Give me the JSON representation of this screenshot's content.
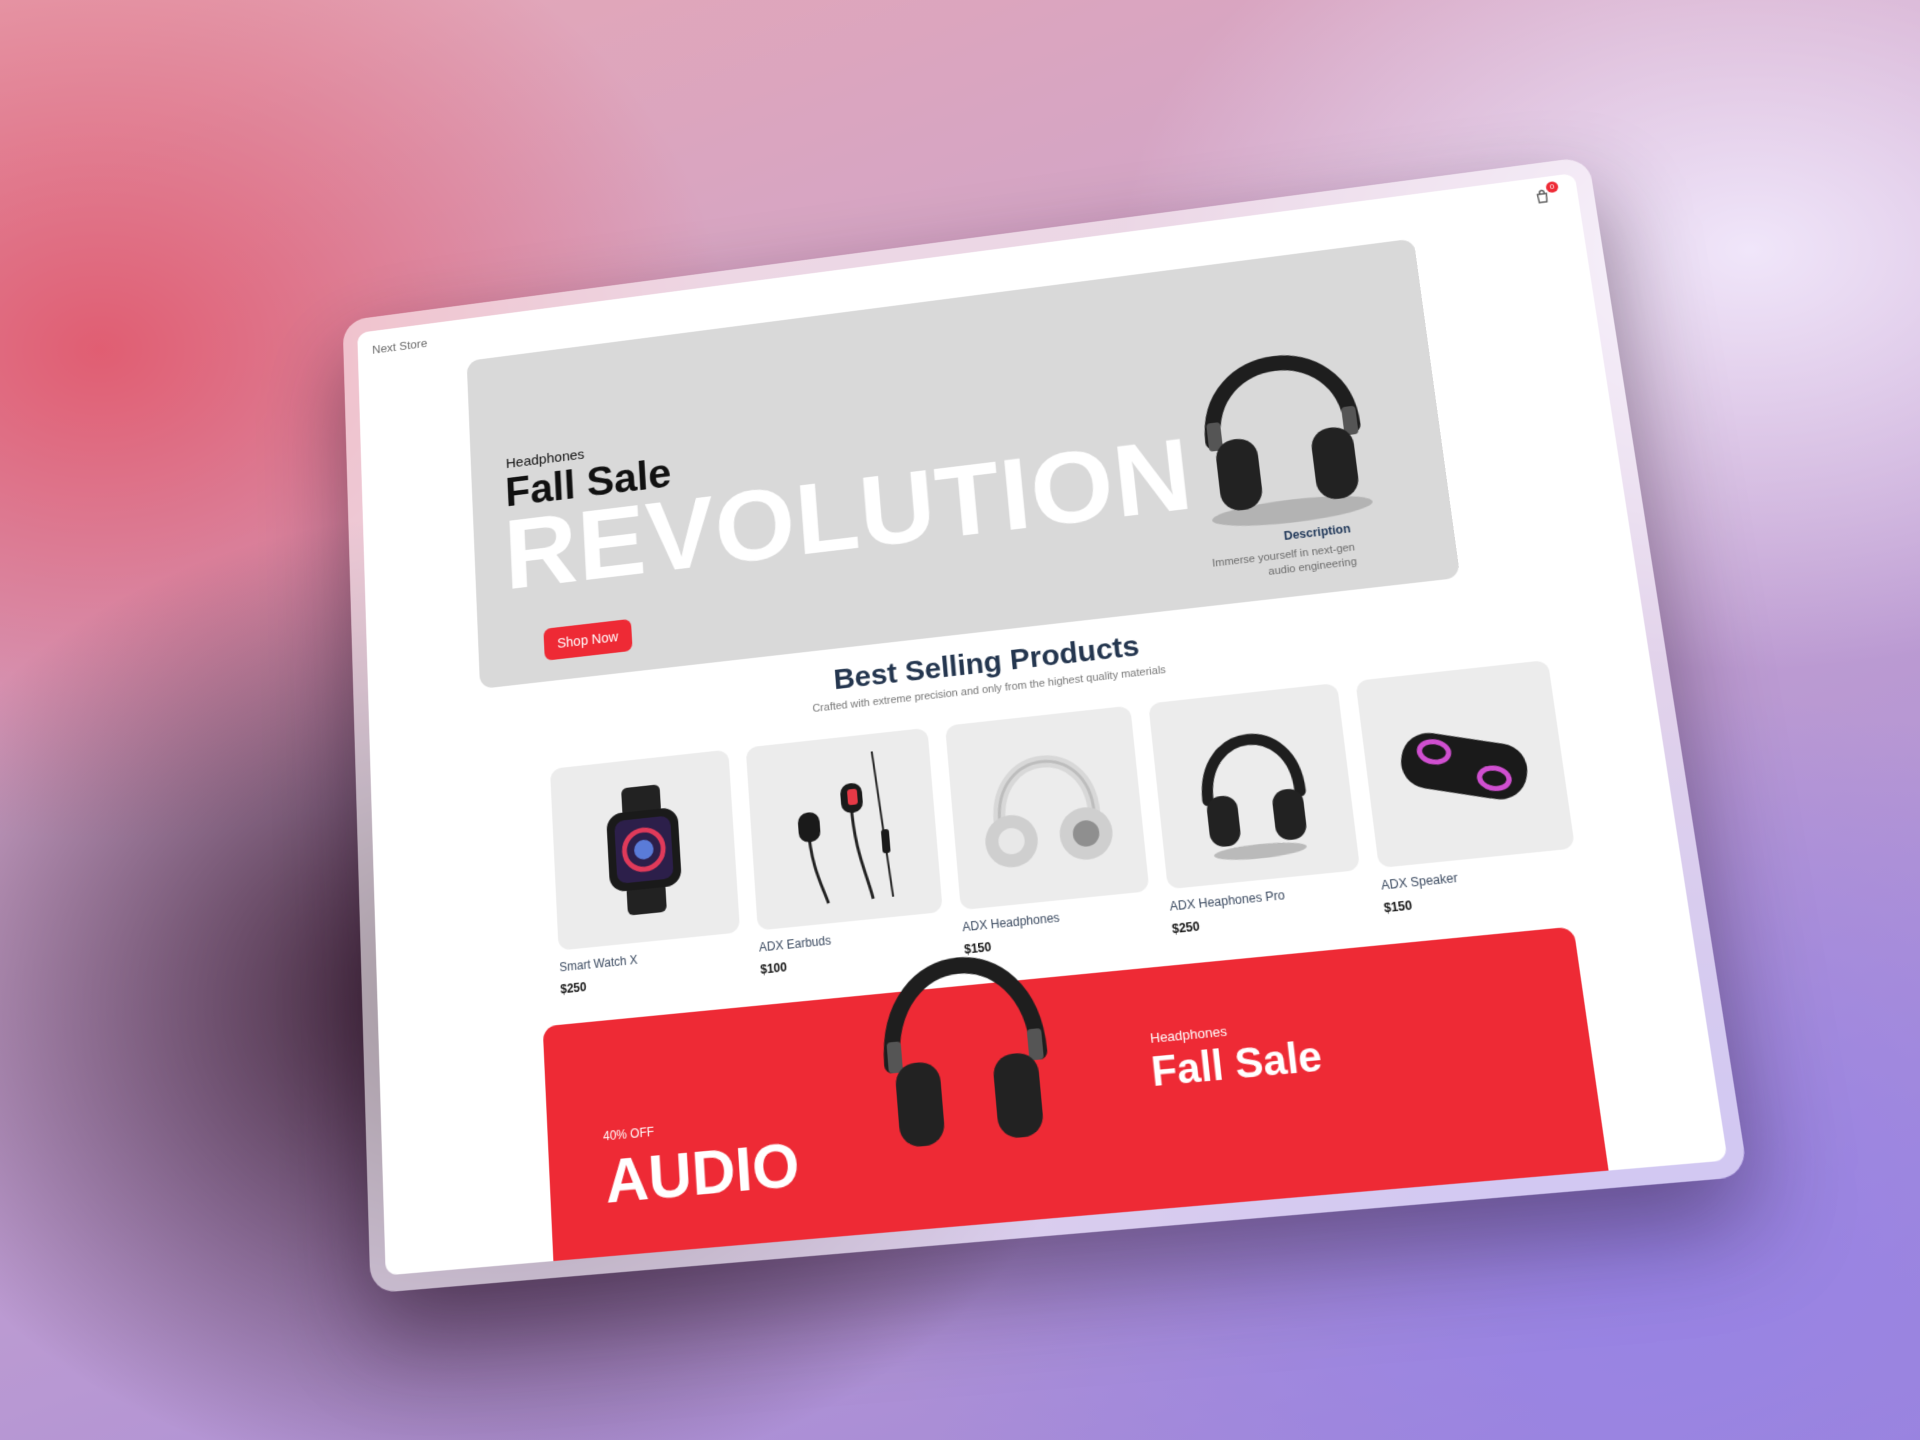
{
  "app": {
    "brand": "Next Store",
    "cart_count": "0"
  },
  "hero": {
    "category": "Headphones",
    "title": "Fall Sale",
    "big_text": "REVOLUTION",
    "button_label": "Shop Now",
    "description_title": "Description",
    "description_text": "Immerse yourself in next-gen audio engineering",
    "image_icon": "headphones-icon"
  },
  "best_selling": {
    "title": "Best Selling Products",
    "subtitle": "Crafted with extreme precision and only from the highest quality materials",
    "products": [
      {
        "name": "Smart Watch X",
        "price": "$250",
        "icon": "smart-watch-icon"
      },
      {
        "name": "ADX Earbuds",
        "price": "$100",
        "icon": "earbuds-icon"
      },
      {
        "name": "ADX Headphones",
        "price": "$150",
        "icon": "headphones-icon"
      },
      {
        "name": "ADX Heaphones Pro",
        "price": "$250",
        "icon": "headphones-icon"
      },
      {
        "name": "ADX Speaker",
        "price": "$150",
        "icon": "speaker-icon"
      }
    ]
  },
  "promo": {
    "discount": "40% OFF",
    "big_text": "AUDIO",
    "category": "Headphones",
    "title": "Fall Sale"
  },
  "colors": {
    "accent": "#ee2a35",
    "hero_bg": "#d9d9d9",
    "heading": "#24364f"
  }
}
